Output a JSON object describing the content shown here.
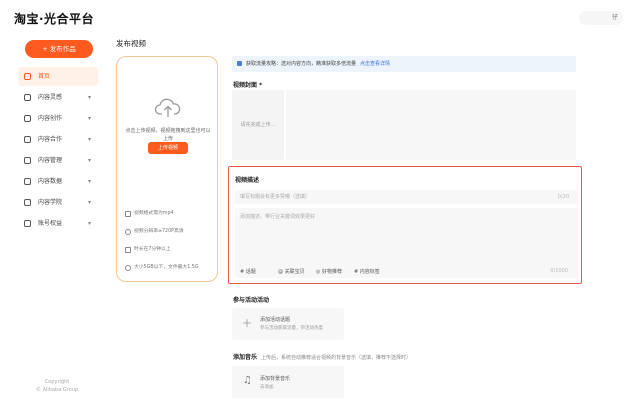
{
  "header": {
    "logo": "淘宝·光合平台",
    "user": "仔"
  },
  "sidebar": {
    "publish_label": "+ 发布作品",
    "items": [
      {
        "label": "首页",
        "icon": "home-icon",
        "has_caret": false
      },
      {
        "label": "内容灵感",
        "icon": "bulb-icon",
        "has_caret": true
      },
      {
        "label": "内容创作",
        "icon": "edit-icon",
        "has_caret": true
      },
      {
        "label": "内容合作",
        "icon": "handshake-icon",
        "has_caret": true
      },
      {
        "label": "内容管理",
        "icon": "folder-icon",
        "has_caret": true
      },
      {
        "label": "内容数据",
        "icon": "chart-icon",
        "has_caret": true
      },
      {
        "label": "内容学院",
        "icon": "book-icon",
        "has_caret": true
      },
      {
        "label": "账号权益",
        "icon": "account-icon",
        "has_caret": true
      }
    ],
    "copyright_line1": "Copyright",
    "copyright_line2": "© Alibaba Group"
  },
  "page": {
    "title": "发布视频"
  },
  "upload": {
    "hint": "点击上传视频，视频拖拽到这里也可以上传",
    "button": "上传视频",
    "requirements": [
      "视频格式需为mp4",
      "视频分辨率≥720P高清",
      "时长在7分钟以上",
      "大小5GB以下，文件最大1.5G"
    ]
  },
  "tip": {
    "text": "获取流量攻略：选对内容方向，精准获取多倍流量",
    "link": "点击查看详情"
  },
  "cover": {
    "label": "视频封面 *",
    "placeholder": "请先完成上传..."
  },
  "description": {
    "label": "视频描述",
    "title_placeholder": "填写标题会有更多赞哦（选填）",
    "title_count": "0/20",
    "body_placeholder": "添加描述，带行业关键词效果更好",
    "tools": [
      "# 话题",
      "@ 关联宝贝",
      "◎ 好物推荐",
      "# 内容标签"
    ],
    "body_count": "0/1000"
  },
  "activity": {
    "label": "参与活动活动",
    "title": "添加活动话题",
    "sub": "参与活动获取流量，带活动热度"
  },
  "music": {
    "label": "添加音乐",
    "hint": "上传后，系统自动推荐适合视频的背景音乐（选填，推荐不选择时）",
    "title": "添加背景音乐",
    "sub": "去添加"
  }
}
